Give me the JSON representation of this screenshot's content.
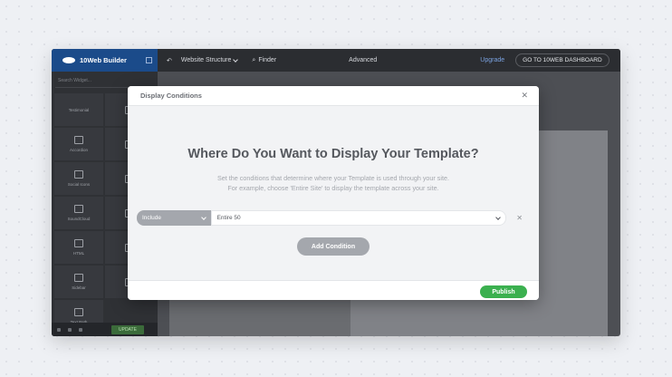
{
  "topbar": {
    "brand": "10Web Builder",
    "website_structure": "Website Structure",
    "finder": "Finder",
    "advanced": "Advanced",
    "upgrade": "Upgrade",
    "dashboard": "GO TO 10WEB DASHBOARD"
  },
  "sidebar": {
    "search_placeholder": "Search Widget...",
    "widgets": [
      "Testimonial",
      "Accordion",
      "Social Icons",
      "SoundCloud",
      "HTML",
      "Sidebar",
      "Text Path"
    ],
    "update_label": "UPDATE"
  },
  "modal": {
    "header": "Display Conditions",
    "title": "Where Do You Want to Display Your Template?",
    "desc_line1": "Set the conditions that determine where your Template is used through your site.",
    "desc_line2": "For example, choose 'Entire Site' to display the template across your site.",
    "include_value": "Include",
    "condition_value": "Entire 50",
    "add_condition": "Add Condition",
    "publish": "Publish"
  }
}
